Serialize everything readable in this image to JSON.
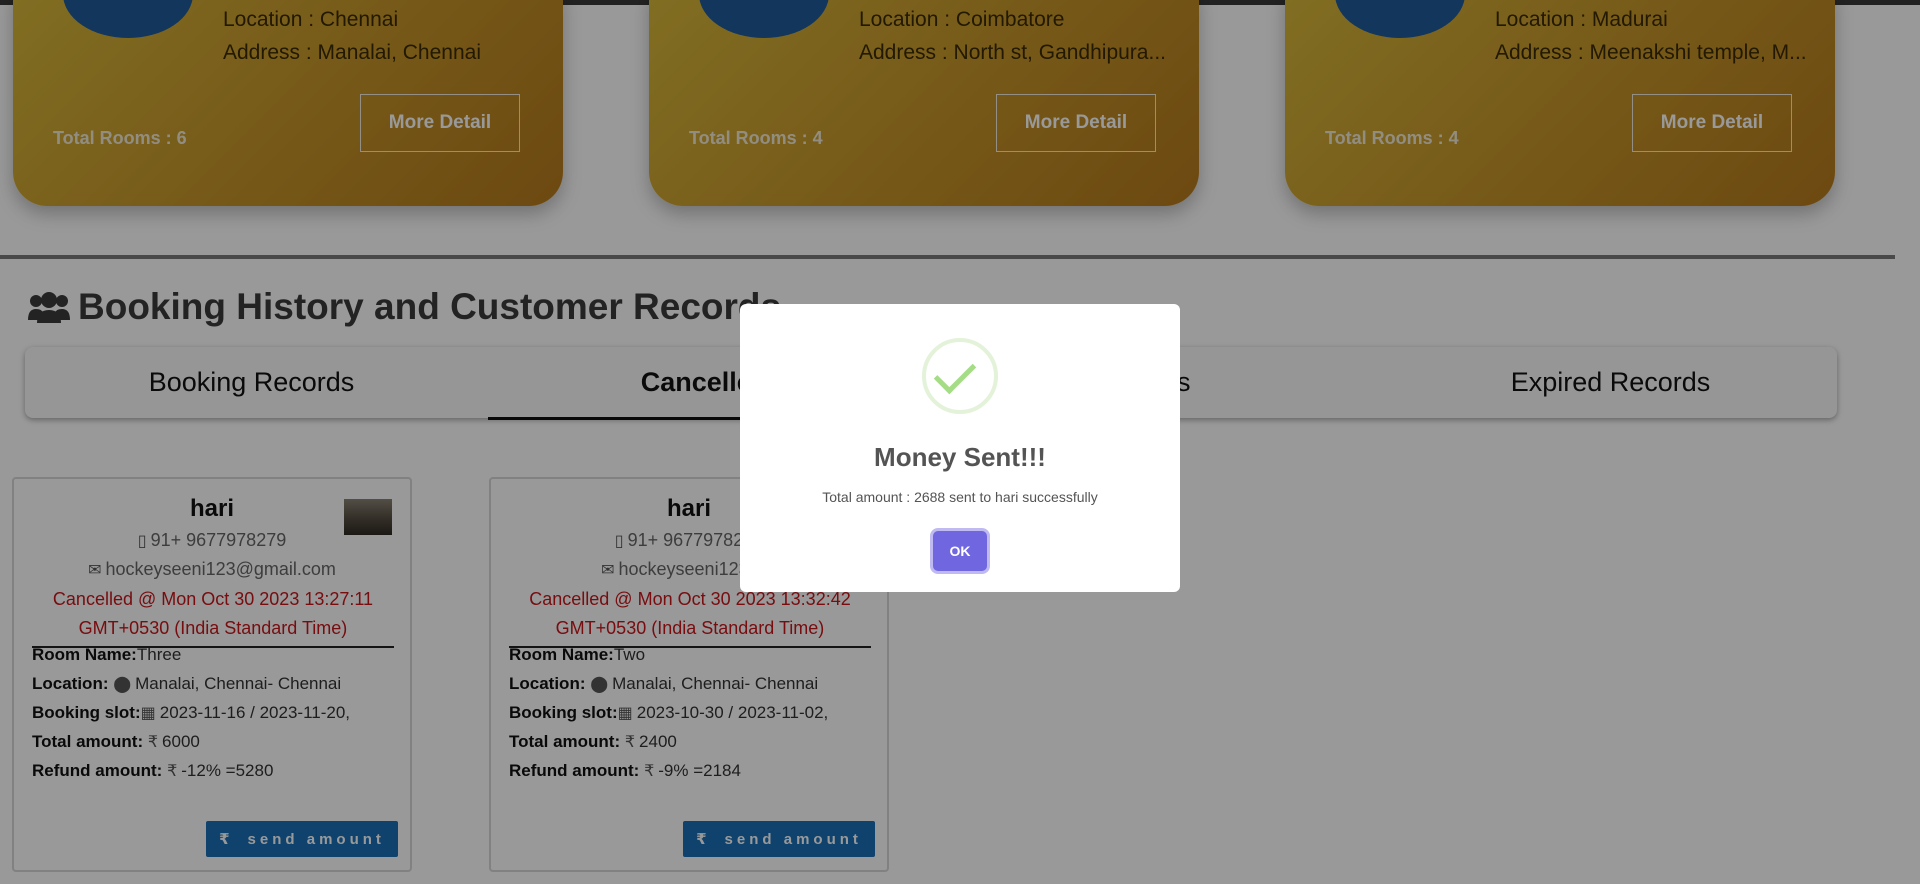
{
  "hotels": [
    {
      "location": "Location : Chennai",
      "address": "Address : Manalai, Chennai",
      "rooms": "Total Rooms : 6",
      "button": "More Detail"
    },
    {
      "location": "Location : Coimbatore",
      "address": "Address : North st, Gandhipura...",
      "rooms": "Total Rooms : 4",
      "button": "More Detail"
    },
    {
      "location": "Location : Madurai",
      "address": "Address : Meenakshi temple, M...",
      "rooms": "Total Rooms : 4",
      "button": "More Detail"
    }
  ],
  "section": {
    "title": "Booking History and Customer Records"
  },
  "tabs": [
    "Booking Records",
    "Cancelled",
    "cords",
    "Expired Records"
  ],
  "bookings": [
    {
      "name": "hari",
      "phone": "91+ 9677978279",
      "email": "hockeyseeni123@gmail.com",
      "cancelled_line1": "Cancelled @ Mon Oct 30 2023 13:27:11",
      "cancelled_line2": "GMT+0530 (India Standard Time)",
      "room_label": "Room Name:",
      "room": "Three",
      "location_label": "Location:",
      "location": "Manalai, Chennai- Chennai",
      "slot_label": "Booking slot:",
      "slot": "2023-11-16 / 2023-11-20,",
      "total_label": "Total amount:",
      "total": "6000",
      "refund_label": "Refund amount:",
      "refund": "-12% =5280",
      "button": "send amount"
    },
    {
      "name": "hari",
      "phone": "91+ 9677978279",
      "email": "hockeyseeni123@g",
      "cancelled_line1": "Cancelled @ Mon Oct 30 2023 13:32:42",
      "cancelled_line2": "GMT+0530 (India Standard Time)",
      "room_label": "Room Name:",
      "room": "Two",
      "location_label": "Location:",
      "location": "Manalai, Chennai- Chennai",
      "slot_label": "Booking slot:",
      "slot": "2023-10-30 / 2023-11-02,",
      "total_label": "Total amount:",
      "total": "2400",
      "refund_label": "Refund amount:",
      "refund": "-9% =2184",
      "button": "send amount"
    }
  ],
  "modal": {
    "title": "Money Sent!!!",
    "text": "Total amount : 2688 sent to hari successfully",
    "ok": "OK"
  }
}
